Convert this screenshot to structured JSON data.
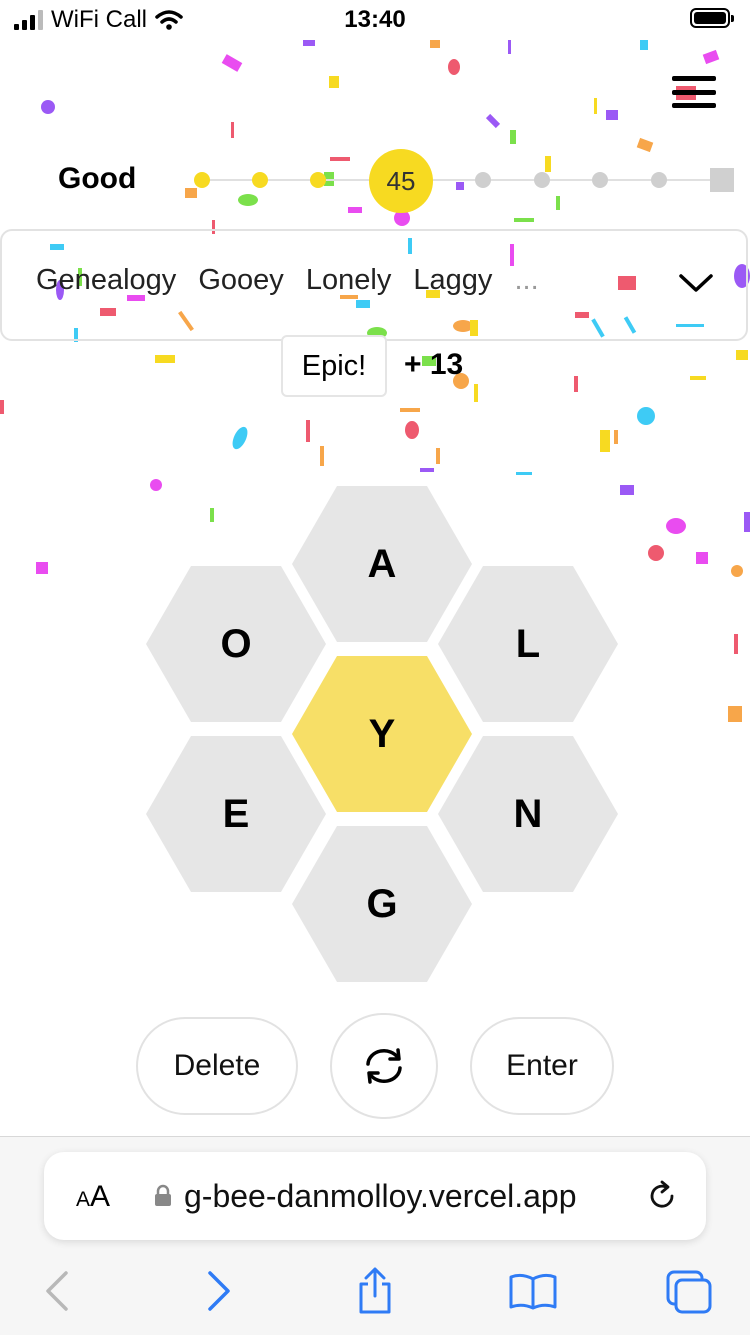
{
  "status_bar": {
    "carrier": "WiFi Call",
    "time": "13:40"
  },
  "progress": {
    "rank": "Good",
    "score": "45",
    "levels_reached": 4,
    "levels_total": 9
  },
  "found_words": {
    "words": [
      "Genealogy",
      "Gooey",
      "Lonely",
      "Laggy"
    ],
    "more": "..."
  },
  "message": {
    "text": "Epic!",
    "points": "+ 13"
  },
  "hive": {
    "center": "Y",
    "outer": [
      "A",
      "O",
      "L",
      "E",
      "N",
      "G"
    ]
  },
  "controls": {
    "delete_label": "Delete",
    "enter_label": "Enter",
    "shuffle_icon": "shuffle-icon"
  },
  "browser": {
    "text_size_label": "AA",
    "url": "g-bee-danmolloy.vercel.app"
  },
  "colors": {
    "accent": "#f7da21",
    "center_hex": "#f7df67",
    "outer_hex": "#e6e6e6",
    "ios_blue": "#2f7bf5"
  }
}
